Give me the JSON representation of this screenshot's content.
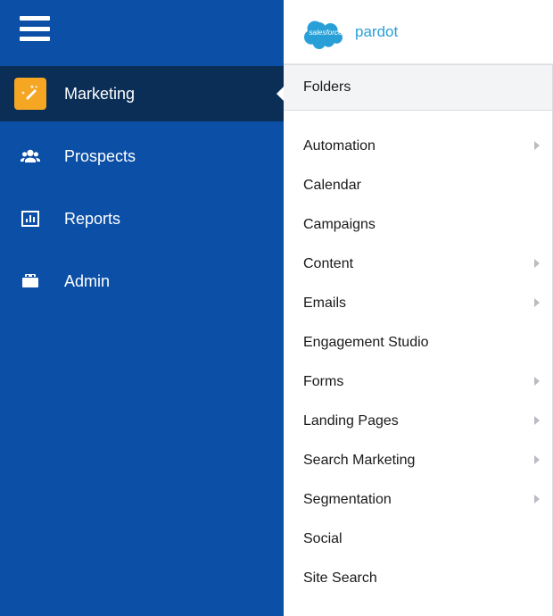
{
  "brand": {
    "cloud_text": "salesforce",
    "product": "pardot"
  },
  "sidebar": {
    "items": [
      {
        "key": "marketing",
        "label": "Marketing",
        "active": true
      },
      {
        "key": "prospects",
        "label": "Prospects",
        "active": false
      },
      {
        "key": "reports",
        "label": "Reports",
        "active": false
      },
      {
        "key": "admin",
        "label": "Admin",
        "active": false
      }
    ]
  },
  "submenu": {
    "selected": "Folders",
    "items": [
      {
        "label": "Automation",
        "has_children": true
      },
      {
        "label": "Calendar",
        "has_children": false
      },
      {
        "label": "Campaigns",
        "has_children": false
      },
      {
        "label": "Content",
        "has_children": true
      },
      {
        "label": "Emails",
        "has_children": true
      },
      {
        "label": "Engagement Studio",
        "has_children": false
      },
      {
        "label": "Forms",
        "has_children": true
      },
      {
        "label": "Landing Pages",
        "has_children": true
      },
      {
        "label": "Search Marketing",
        "has_children": true
      },
      {
        "label": "Segmentation",
        "has_children": true
      },
      {
        "label": "Social",
        "has_children": false
      },
      {
        "label": "Site Search",
        "has_children": false
      }
    ]
  }
}
